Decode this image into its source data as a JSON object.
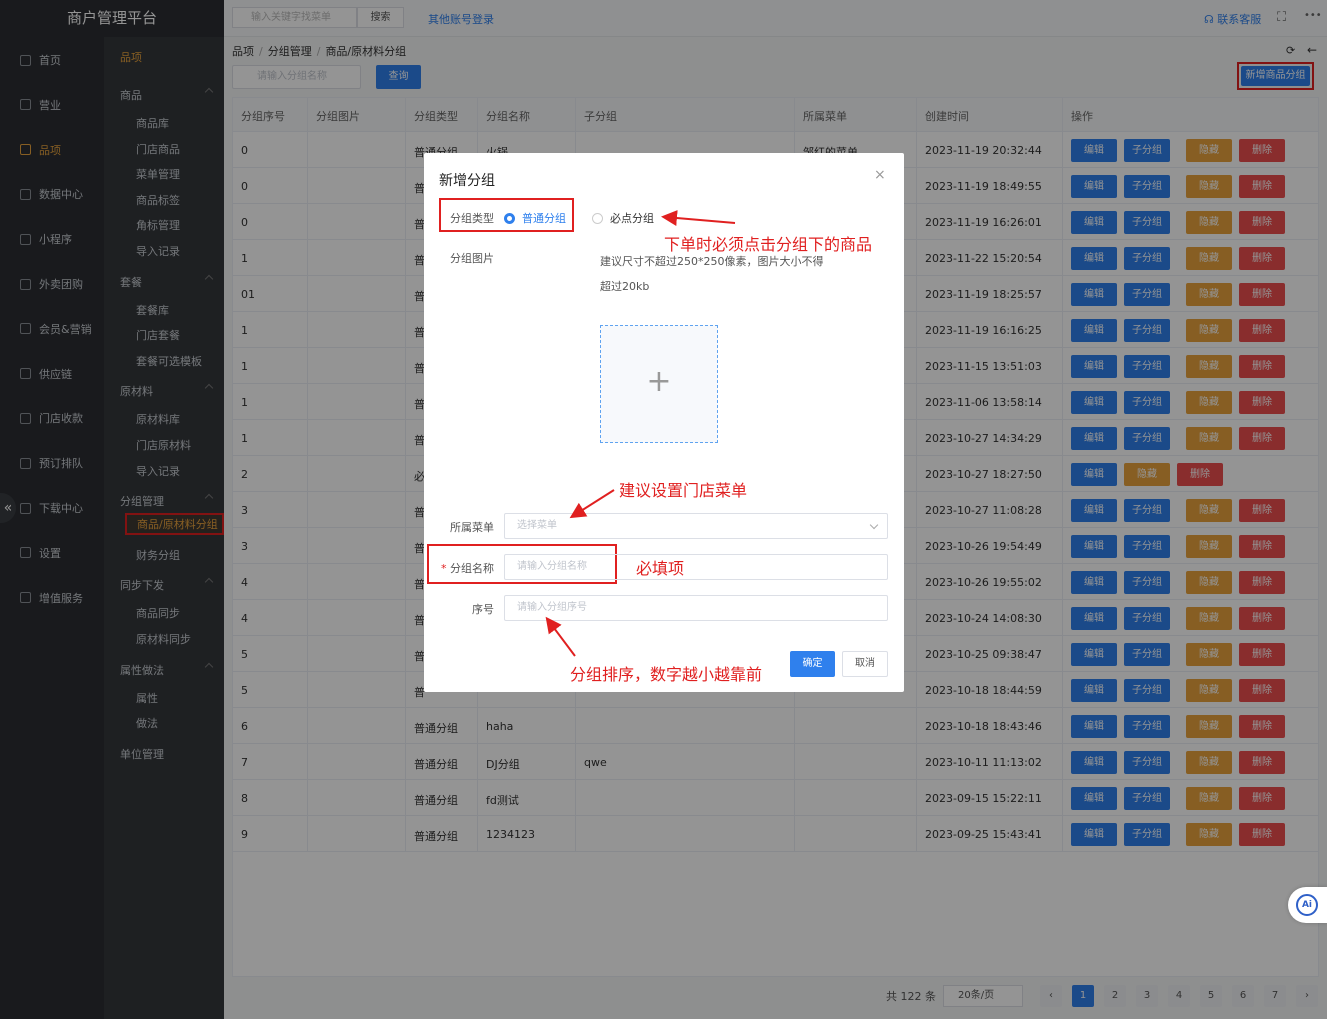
{
  "app": {
    "title": "商户管理平台"
  },
  "sidebar": {
    "items": [
      {
        "label": "首页",
        "icon": "home-icon"
      },
      {
        "label": "营业",
        "icon": "calendar-icon"
      },
      {
        "label": "品项",
        "icon": "bag-icon",
        "active": true
      },
      {
        "label": "数据中心",
        "icon": "share-icon"
      },
      {
        "label": "小程序",
        "icon": "phone-icon"
      },
      {
        "label": "外卖团购",
        "icon": "bike-icon"
      },
      {
        "label": "会员&营销",
        "icon": "user-icon"
      },
      {
        "label": "供应链",
        "icon": "truck-icon"
      },
      {
        "label": "门店收款",
        "icon": "database-icon"
      },
      {
        "label": "预订排队",
        "icon": "clock-icon"
      },
      {
        "label": "下载中心",
        "icon": "download-icon"
      },
      {
        "label": "设置",
        "icon": "gear-icon"
      },
      {
        "label": "增值服务",
        "icon": "alarm-icon"
      }
    ],
    "collapse": "«"
  },
  "subnav": {
    "title": "品项",
    "groups": [
      {
        "label": "商品",
        "items": [
          "商品库",
          "门店商品",
          "菜单管理",
          "商品标签",
          "角标管理",
          "导入记录"
        ]
      },
      {
        "label": "套餐",
        "items": [
          "套餐库",
          "门店套餐",
          "套餐可选模板"
        ]
      },
      {
        "label": "原材料",
        "items": [
          "原材料库",
          "门店原材料",
          "导入记录"
        ]
      },
      {
        "label": "分组管理",
        "items": [
          "商品/原材料分组",
          "财务分组"
        ]
      },
      {
        "label": "同步下发",
        "items": [
          "商品同步",
          "原材料同步"
        ]
      },
      {
        "label": "属性做法",
        "items": [
          "属性",
          "做法"
        ]
      },
      {
        "label": "单位管理",
        "items": []
      }
    ]
  },
  "topbar": {
    "search_placeholder": "输入关键字找菜单",
    "search_btn": "搜索",
    "other_login": "其他账号登录",
    "service": "联系客服",
    "more": "•••"
  },
  "breadcrumb": [
    "品项",
    "分组管理",
    "商品/原材料分组"
  ],
  "filter": {
    "placeholder": "请输入分组名称",
    "query": "查询",
    "new": "新增商品分组"
  },
  "table": {
    "headers": [
      "分组序号",
      "分组图片",
      "分组类型",
      "分组名称",
      "子分组",
      "所属菜单",
      "创建时间",
      "操作"
    ],
    "actions": {
      "edit": "编辑",
      "sub": "子分组",
      "hide": "隐藏",
      "del": "删除"
    },
    "rows": [
      {
        "seq": "0",
        "type": "普通分组",
        "name": "火锅",
        "sub": "",
        "menu": "邹红的菜单",
        "time": "2023-11-19 20:32:44",
        "has_sub": true
      },
      {
        "seq": "0",
        "type": "普",
        "name": "",
        "sub": "",
        "menu": "",
        "time": "2023-11-19 18:49:55",
        "has_sub": true
      },
      {
        "seq": "0",
        "type": "普",
        "name": "",
        "sub": "",
        "menu": "",
        "time": "2023-11-19 16:26:01",
        "has_sub": true
      },
      {
        "seq": "1",
        "type": "普",
        "name": "",
        "sub": "",
        "menu": "",
        "time": "2023-11-22 15:20:54",
        "has_sub": true
      },
      {
        "seq": "01",
        "type": "普",
        "name": "",
        "sub": "",
        "menu": "",
        "time": "2023-11-19 18:25:57",
        "has_sub": true
      },
      {
        "seq": "1",
        "type": "普",
        "name": "",
        "sub": "",
        "menu": "",
        "time": "2023-11-19 16:16:25",
        "has_sub": true
      },
      {
        "seq": "1",
        "type": "普",
        "name": "",
        "sub": "",
        "menu": "",
        "time": "2023-11-15 13:51:03",
        "has_sub": true
      },
      {
        "seq": "1",
        "type": "普",
        "name": "",
        "sub": "",
        "menu": "",
        "time": "2023-11-06 13:58:14",
        "has_sub": true
      },
      {
        "seq": "1",
        "type": "普",
        "name": "",
        "sub": "",
        "menu": "",
        "time": "2023-10-27 14:34:29",
        "has_sub": true
      },
      {
        "seq": "2",
        "type": "必",
        "name": "",
        "sub": "",
        "menu": "",
        "time": "2023-10-27 18:27:50",
        "has_sub": false
      },
      {
        "seq": "3",
        "type": "普",
        "name": "",
        "sub": "",
        "menu": "",
        "time": "2023-10-27 11:08:28",
        "has_sub": true
      },
      {
        "seq": "3",
        "type": "普",
        "name": "",
        "sub": "",
        "menu": "",
        "time": "2023-10-26 19:54:49",
        "has_sub": true
      },
      {
        "seq": "4",
        "type": "普",
        "name": "",
        "sub": "",
        "menu": "",
        "time": "2023-10-26 19:55:02",
        "has_sub": true
      },
      {
        "seq": "4",
        "type": "普",
        "name": "",
        "sub": "",
        "menu": "",
        "time": "2023-10-24 14:08:30",
        "has_sub": true
      },
      {
        "seq": "5",
        "type": "普",
        "name": "",
        "sub": "",
        "menu": "",
        "time": "2023-10-25 09:38:47",
        "has_sub": true
      },
      {
        "seq": "5",
        "type": "普",
        "name": "",
        "sub": "",
        "menu": "",
        "time": "2023-10-18 18:44:59",
        "has_sub": true
      },
      {
        "seq": "6",
        "type": "普通分组",
        "name": "haha",
        "sub": "",
        "menu": "",
        "time": "2023-10-18 18:43:46",
        "has_sub": true
      },
      {
        "seq": "7",
        "type": "普通分组",
        "name": "DJ分组",
        "sub": "qwe",
        "menu": "",
        "time": "2023-10-11 11:13:02",
        "has_sub": true
      },
      {
        "seq": "8",
        "type": "普通分组",
        "name": "fd测试",
        "sub": "",
        "menu": "",
        "time": "2023-09-15 15:22:11",
        "has_sub": true
      },
      {
        "seq": "9",
        "type": "普通分组",
        "name": "1234123",
        "sub": "",
        "menu": "",
        "time": "2023-09-25 15:43:41",
        "has_sub": true
      }
    ]
  },
  "pager": {
    "total": "共 122 条",
    "size": "20条/页",
    "pages": [
      "1",
      "2",
      "3",
      "4",
      "5",
      "6",
      "7"
    ],
    "prev": "‹",
    "next": "›"
  },
  "modal": {
    "title": "新增分组",
    "close": "×",
    "type_label": "分组类型",
    "radio_normal": "普通分组",
    "radio_must": "必点分组",
    "image_label": "分组图片",
    "image_hint_1": "建议尺寸不超过250*250像素，图片大小不得",
    "image_hint_2": "超过20kb",
    "upload_plus": "+",
    "menu_label": "所属菜单",
    "menu_placeholder": "选择菜单",
    "name_label": "分组名称",
    "required_mark": "*",
    "name_placeholder": "请输入分组名称",
    "seq_label": "序号",
    "seq_placeholder": "请输入分组序号",
    "ok": "确定",
    "cancel": "取消"
  },
  "annotations": {
    "must_group": "下单时必须点击分组下的商品",
    "menu_tip": "建议设置门店菜单",
    "required": "必填项",
    "sort_tip": "分组排序，数字越小越靠前"
  },
  "ai_badge": "Ai"
}
